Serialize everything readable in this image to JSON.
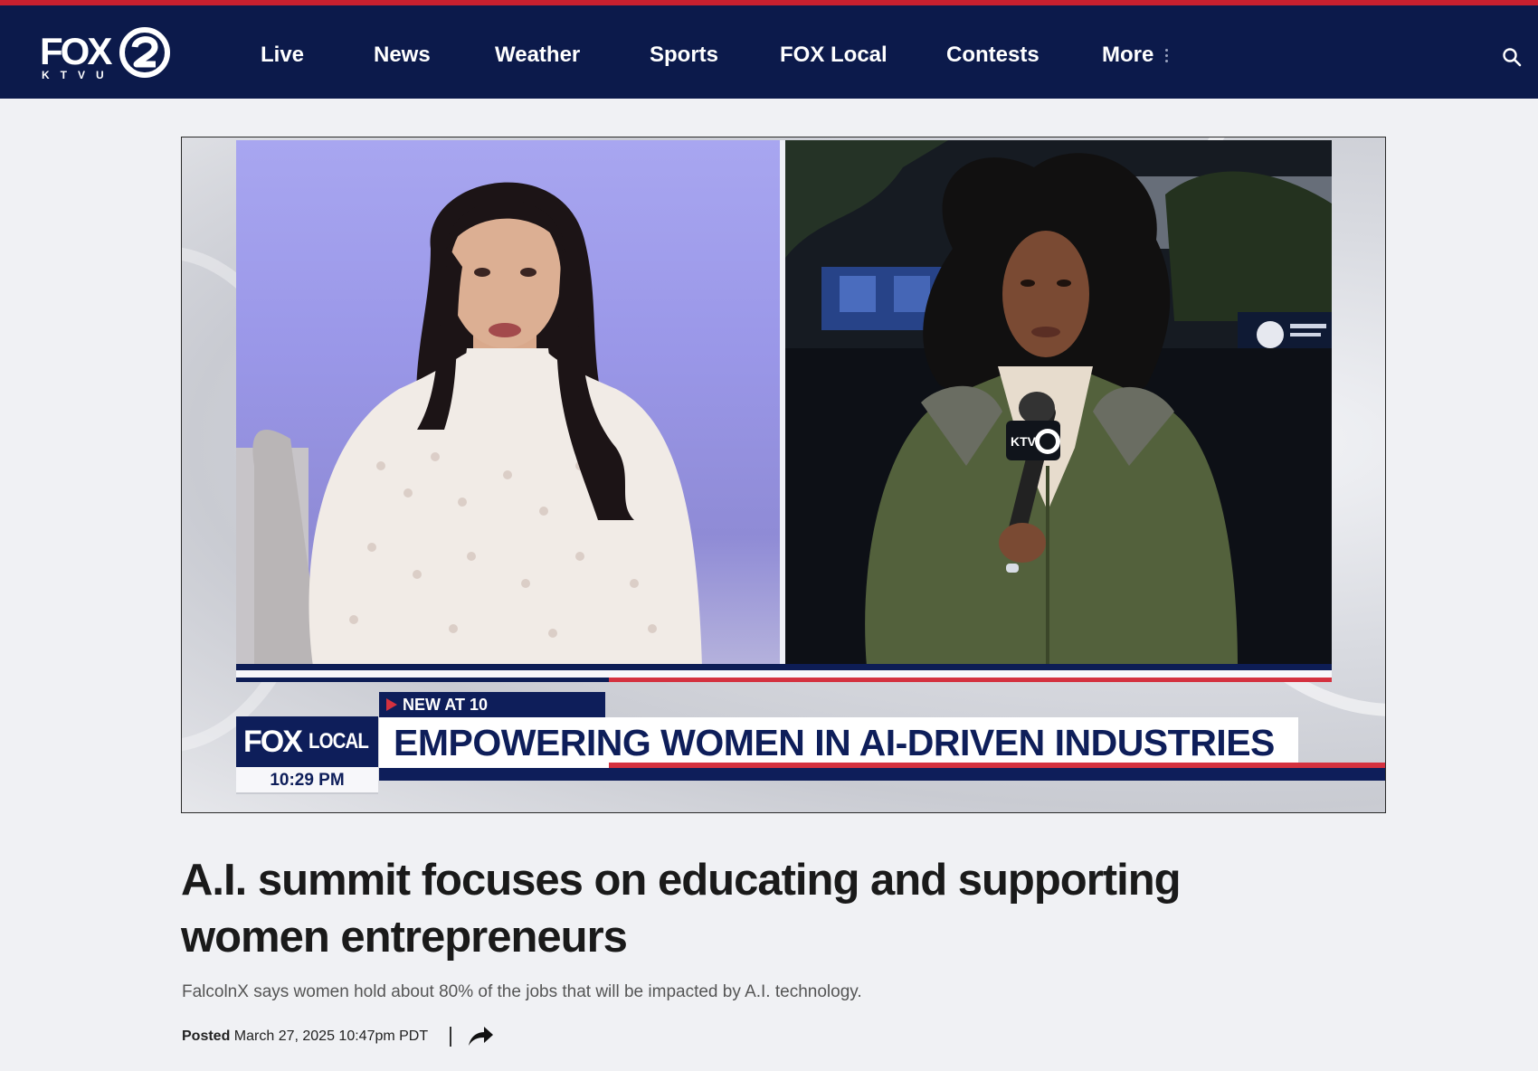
{
  "brand": {
    "logo_text": "FOX",
    "logo_sub": "KTVU",
    "logo_number": "2"
  },
  "nav": {
    "items": [
      {
        "label": "Live"
      },
      {
        "label": "News"
      },
      {
        "label": "Weather"
      },
      {
        "label": "Sports"
      },
      {
        "label": "FOX Local"
      },
      {
        "label": "Contests"
      },
      {
        "label": "More"
      }
    ],
    "search_icon": "search-icon"
  },
  "video": {
    "tag": "NEW AT 10",
    "brand_fox": "FOX",
    "brand_local": "LOCAL",
    "time": "10:29 PM",
    "headline": "EMPOWERING WOMEN IN AI-DRIVEN INDUSTRIES",
    "mic_flag": "KTVU"
  },
  "article": {
    "title": "A.I. summit focuses on educating and supporting women entrepreneurs",
    "subtitle": "FalcolnX says women hold about 80% of the jobs that will be impacted by A.I. technology.",
    "posted_label": "Posted",
    "posted_date": "March 27, 2025 10:47pm PDT",
    "share_icon": "share-arrow-icon"
  },
  "colors": {
    "nav_bg": "#0c1a4b",
    "accent_red": "#c8202f",
    "page_bg": "#f0f1f4",
    "lower_third_navy": "#0e1e5a"
  }
}
